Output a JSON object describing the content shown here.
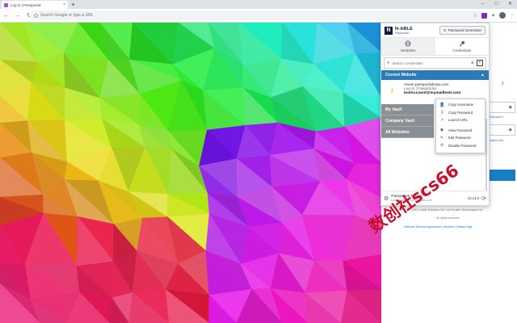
{
  "browser": {
    "tab_title": "Log In | Passportal",
    "tab_close": "×",
    "new_tab": "+",
    "omnibox_placeholder": "Search Google or type a URL",
    "window_controls": [
      "–",
      "□",
      "✕"
    ]
  },
  "popup": {
    "brand": "N-ABLE",
    "brand_sub": "Passportal",
    "generator_label": "Password Generator",
    "tabs": [
      {
        "label": "Websites",
        "icon": "globe-icon",
        "active": true
      },
      {
        "label": "Credentials",
        "icon": "key-icon",
        "active": false
      }
    ],
    "search_placeholder": "Search Credentials",
    "current_website_label": "Current Website",
    "credential": {
      "url": "clover.passportalmsp.com",
      "name": "Log In | Passportal",
      "username": "testAccount@mymailtestr.com"
    },
    "sections": [
      "My Vault",
      "Company Vault",
      "All Websites"
    ],
    "context_menu": [
      {
        "label": "Copy Username",
        "icon": "user-icon"
      },
      {
        "label": "Copy Password",
        "icon": "key-icon"
      },
      {
        "label": "Launch URL",
        "icon": "external-link-icon"
      },
      {
        "label": "View Password",
        "icon": "eye-icon"
      },
      {
        "label": "Edit Password",
        "icon": "pencil-icon"
      },
      {
        "label": "Disable Password",
        "icon": "block-icon"
      }
    ],
    "footer": {
      "user": "Passportal Tester",
      "email": "passportaltester@mailinator.com",
      "version": "v3.14.0"
    }
  },
  "page": {
    "forgot_password": "Password?",
    "location_key": "ication Key",
    "copyright": "© 2021 N-able Solutions ULC and N-able Technologies Ltd.",
    "rights": "All rights reserved.",
    "links": "Software Services Agreement  |  Sandbox  |  Status Page"
  },
  "watermark": "数创社scs66"
}
